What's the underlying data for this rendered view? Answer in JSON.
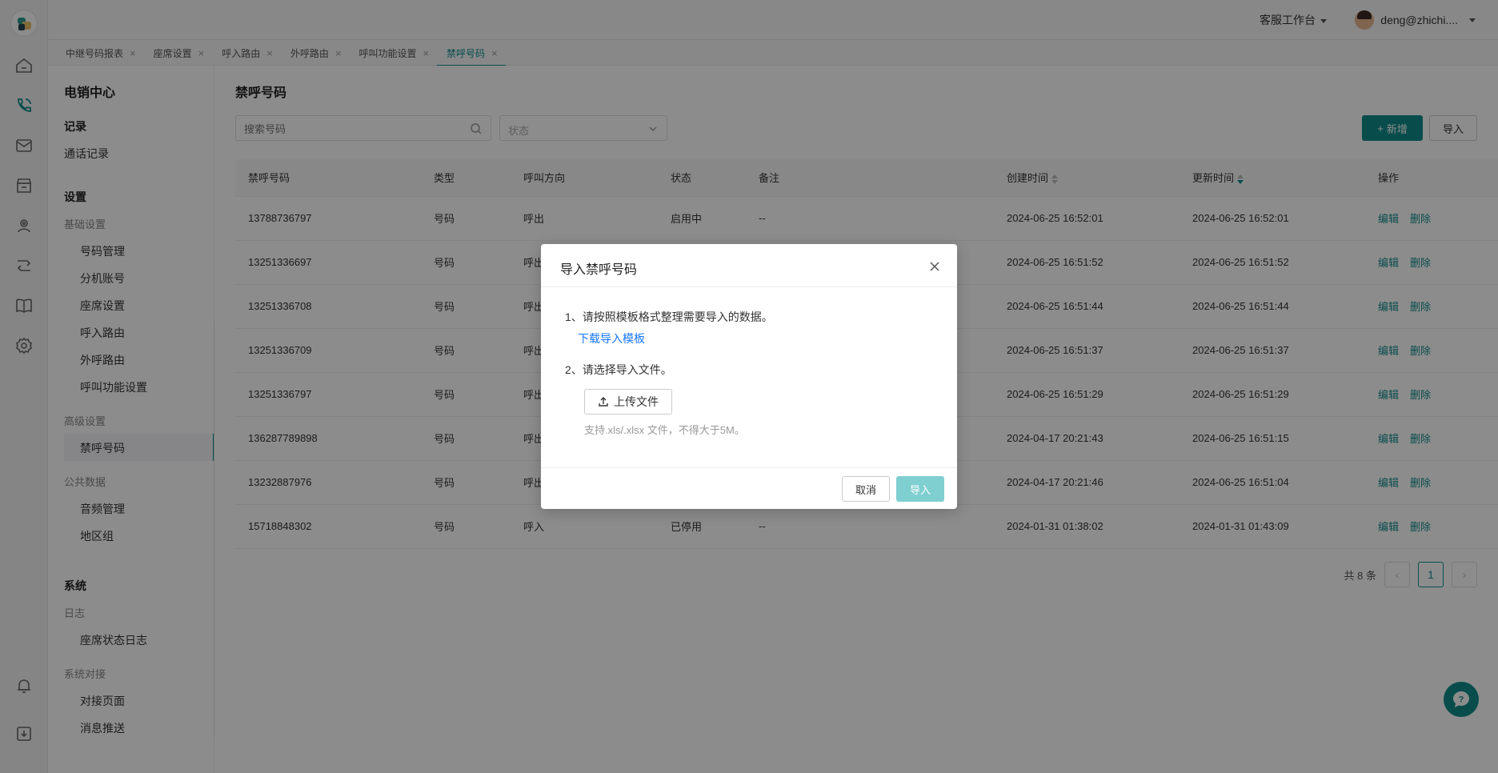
{
  "topbar": {
    "workbench": "客服工作台",
    "user": "deng@zhichi...."
  },
  "tabs": [
    {
      "label": "中继号码报表"
    },
    {
      "label": "座席设置"
    },
    {
      "label": "呼入路由"
    },
    {
      "label": "外呼路由"
    },
    {
      "label": "呼叫功能设置"
    },
    {
      "label": "禁呼号码"
    }
  ],
  "sidebar": {
    "title": "电销中心",
    "record_section": "记录",
    "call_records": "通话记录",
    "settings_section": "设置",
    "basic_group": "基础设置",
    "number_mgmt": "号码管理",
    "ext_account": "分机账号",
    "seat_settings": "座席设置",
    "inbound_route": "呼入路由",
    "outbound_route": "外呼路由",
    "call_func": "呼叫功能设置",
    "advanced_group": "高级设置",
    "blocked_numbers": "禁呼号码",
    "public_group": "公共数据",
    "audio_mgmt": "音频管理",
    "region_group": "地区组",
    "system_section": "系统",
    "log_group": "日志",
    "seat_log": "座席状态日志",
    "integration_group": "系统对接",
    "integration_page": "对接页面",
    "msg_push": "消息推送"
  },
  "main": {
    "title": "禁呼号码",
    "search_placeholder": "搜索号码",
    "status_placeholder": "状态",
    "new_label": "新增",
    "import_label": "导入"
  },
  "table": {
    "headers": [
      "禁呼号码",
      "类型",
      "呼叫方向",
      "状态",
      "备注",
      "创建时间",
      "更新时间",
      "操作"
    ],
    "edit": "编辑",
    "delete": "删除",
    "rows": [
      [
        "13788736797",
        "号码",
        "呼出",
        "启用中",
        "--",
        "2024-06-25 16:52:01",
        "2024-06-25 16:52:01"
      ],
      [
        "13251336697",
        "号码",
        "呼出",
        "",
        "",
        "2024-06-25 16:51:52",
        "2024-06-25 16:51:52"
      ],
      [
        "13251336708",
        "号码",
        "呼出",
        "",
        "",
        "2024-06-25 16:51:44",
        "2024-06-25 16:51:44"
      ],
      [
        "13251336709",
        "号码",
        "呼出",
        "",
        "",
        "2024-06-25 16:51:37",
        "2024-06-25 16:51:37"
      ],
      [
        "13251336797",
        "号码",
        "呼出",
        "",
        "",
        "2024-06-25 16:51:29",
        "2024-06-25 16:51:29"
      ],
      [
        "136287789898",
        "号码",
        "呼出",
        "",
        "",
        "2024-04-17 20:21:43",
        "2024-06-25 16:51:15"
      ],
      [
        "13232887976",
        "号码",
        "呼出",
        "",
        "",
        "2024-04-17 20:21:46",
        "2024-06-25 16:51:04"
      ],
      [
        "15718848302",
        "号码",
        "呼入",
        "已停用",
        "--",
        "2024-01-31 01:38:02",
        "2024-01-31 01:43:09"
      ]
    ]
  },
  "pager": {
    "total": "共 8 条",
    "current": "1",
    "prev": "‹",
    "next": "›"
  },
  "modal": {
    "title": "导入禁呼号码",
    "step1": "1、请按照模板格式整理需要导入的数据。",
    "download": "下载导入模板",
    "step2": "2、请选择导入文件。",
    "upload": "上传文件",
    "tip": "支持.xls/.xlsx 文件，不得大于5M。",
    "cancel": "取消",
    "confirm": "导入"
  },
  "colors": {
    "accent": "#0f8c8a",
    "link": "#1677ff",
    "overlay": "rgba(0,0,0,0.45)"
  },
  "icons": [
    "home-icon",
    "phone-icon",
    "mail-icon",
    "store-icon",
    "agent-icon",
    "route-icon",
    "book-icon",
    "gear-icon",
    "bell-icon",
    "download-icon",
    "help-icon"
  ]
}
